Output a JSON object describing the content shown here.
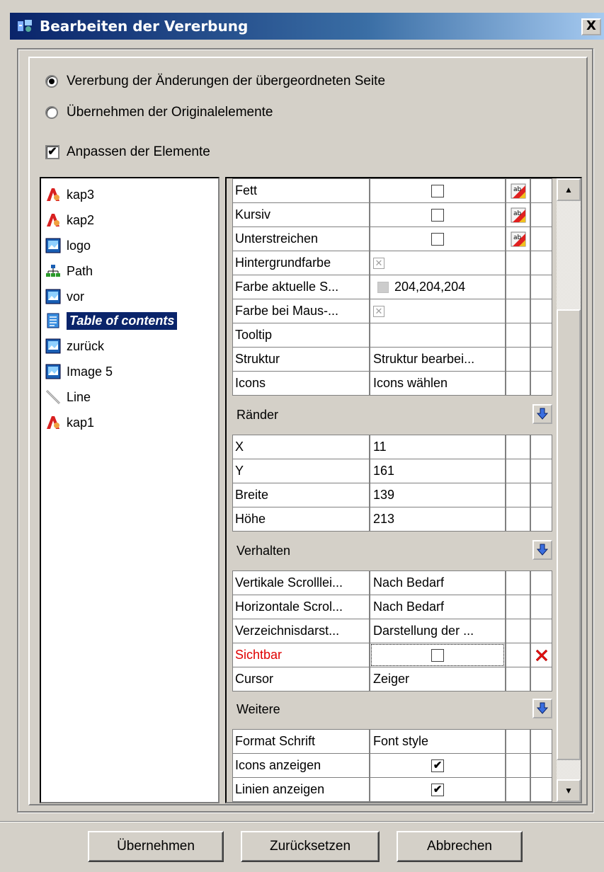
{
  "window": {
    "title": "Bearbeiten der Vererbung",
    "close_label": "X"
  },
  "options": {
    "radio_inherit": "Vererbung der Änderungen der übergeordneten Seite",
    "radio_original": "Übernehmen der Originalelemente",
    "checkbox_customize": "Anpassen der Elemente",
    "radio_inherit_selected": true,
    "checkbox_customize_checked": true
  },
  "tree": {
    "items": [
      {
        "label": "kap3",
        "icon": "button-icon"
      },
      {
        "label": "kap2",
        "icon": "button-icon"
      },
      {
        "label": "logo",
        "icon": "image-icon"
      },
      {
        "label": "Path",
        "icon": "sitemap-icon"
      },
      {
        "label": "vor",
        "icon": "image-icon"
      },
      {
        "label": "Table of contents",
        "icon": "toc-icon",
        "selected": true
      },
      {
        "label": "zurück",
        "icon": "image-icon"
      },
      {
        "label": "Image 5",
        "icon": "image-icon"
      },
      {
        "label": "Line",
        "icon": "line-icon"
      },
      {
        "label": "kap1",
        "icon": "button-icon"
      }
    ]
  },
  "properties": {
    "rows_top": [
      {
        "name": "Fett",
        "value": "",
        "type": "checkbox",
        "checked": false,
        "flag": "font-icon"
      },
      {
        "name": "Kursiv",
        "value": "",
        "type": "checkbox",
        "checked": false,
        "flag": "font-icon"
      },
      {
        "name": "Unterstreichen",
        "value": "",
        "type": "checkbox",
        "checked": false,
        "flag": "font-icon"
      },
      {
        "name": "Hintergrundfarbe",
        "value": "",
        "type": "nocolor"
      },
      {
        "name": "Farbe aktuelle S...",
        "value": "204,204,204",
        "type": "color",
        "color": "#cccccc"
      },
      {
        "name": "Farbe bei Maus-...",
        "value": "",
        "type": "nocolor"
      },
      {
        "name": "Tooltip",
        "value": "",
        "type": "text"
      },
      {
        "name": "Struktur",
        "value": "Struktur bearbei...",
        "type": "text"
      },
      {
        "name": "Icons",
        "value": "Icons wählen",
        "type": "text"
      }
    ],
    "section_margins": "Ränder",
    "rows_margins": [
      {
        "name": "X",
        "value": "11"
      },
      {
        "name": "Y",
        "value": "161"
      },
      {
        "name": "Breite",
        "value": "139"
      },
      {
        "name": "Höhe",
        "value": "213"
      }
    ],
    "section_behavior": "Verhalten",
    "rows_behavior": [
      {
        "name": "Vertikale Scrolllei...",
        "value": "Nach Bedarf"
      },
      {
        "name": "Horizontale Scrol...",
        "value": "Nach Bedarf"
      },
      {
        "name": "Verzeichnisdarst...",
        "value": "Darstellung der ..."
      },
      {
        "name": "Sichtbar",
        "value": "",
        "type": "checkbox",
        "checked": false,
        "modified": true
      },
      {
        "name": "Cursor",
        "value": "Zeiger"
      }
    ],
    "section_more": "Weitere",
    "rows_more": [
      {
        "name": "Format Schrift",
        "value": "Font style"
      },
      {
        "name": "Icons anzeigen",
        "value": "",
        "type": "checkbox",
        "checked": true
      },
      {
        "name": "Linien anzeigen",
        "value": "",
        "type": "checkbox",
        "checked": true
      }
    ]
  },
  "buttons": {
    "apply": "Übernehmen",
    "reset": "Zurücksetzen",
    "cancel": "Abbrechen"
  },
  "colors": {
    "titlebar": "#0a246a",
    "selection": "#0a246a",
    "modified_text": "#e00000",
    "face": "#d4d0c8"
  }
}
